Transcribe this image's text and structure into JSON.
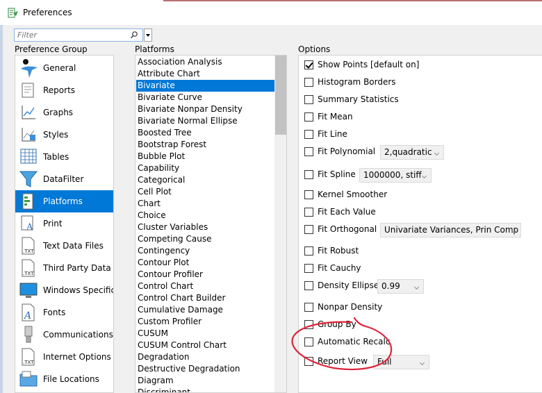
{
  "window": {
    "title": "Preferences"
  },
  "filter": {
    "placeholder": "Filter"
  },
  "labels": {
    "preference_group": "Preference Group",
    "platforms": "Platforms",
    "options": "Options"
  },
  "preference_groups": [
    {
      "label": "General",
      "icon": "general-icon",
      "selected": false
    },
    {
      "label": "Reports",
      "icon": "reports-icon",
      "selected": false
    },
    {
      "label": "Graphs",
      "icon": "graphs-icon",
      "selected": false
    },
    {
      "label": "Styles",
      "icon": "styles-icon",
      "selected": false
    },
    {
      "label": "Tables",
      "icon": "tables-icon",
      "selected": false
    },
    {
      "label": "DataFilter",
      "icon": "datafilter-icon",
      "selected": false
    },
    {
      "label": "Platforms",
      "icon": "platforms-icon",
      "selected": true
    },
    {
      "label": "Print",
      "icon": "print-icon",
      "selected": false
    },
    {
      "label": "Text Data Files",
      "icon": "text-data-files-icon",
      "selected": false
    },
    {
      "label": "Third Party Data",
      "icon": "third-party-data-icon",
      "selected": false
    },
    {
      "label": "Windows Specific",
      "icon": "windows-specific-icon",
      "selected": false
    },
    {
      "label": "Fonts",
      "icon": "fonts-icon",
      "selected": false
    },
    {
      "label": "Communications",
      "icon": "communications-icon",
      "selected": false
    },
    {
      "label": "Internet Options",
      "icon": "internet-options-icon",
      "selected": false
    },
    {
      "label": "File Locations",
      "icon": "file-locations-icon",
      "selected": false
    }
  ],
  "platforms": [
    {
      "label": "Association Analysis",
      "selected": false
    },
    {
      "label": "Attribute Chart",
      "selected": false
    },
    {
      "label": "Bivariate",
      "selected": true
    },
    {
      "label": "Bivariate Curve",
      "selected": false
    },
    {
      "label": "Bivariate Nonpar Density",
      "selected": false
    },
    {
      "label": "Bivariate Normal Ellipse",
      "selected": false
    },
    {
      "label": "Boosted Tree",
      "selected": false
    },
    {
      "label": "Bootstrap Forest",
      "selected": false
    },
    {
      "label": "Bubble Plot",
      "selected": false
    },
    {
      "label": "Capability",
      "selected": false
    },
    {
      "label": "Categorical",
      "selected": false
    },
    {
      "label": "Cell Plot",
      "selected": false
    },
    {
      "label": "Chart",
      "selected": false
    },
    {
      "label": "Choice",
      "selected": false
    },
    {
      "label": "Cluster Variables",
      "selected": false
    },
    {
      "label": "Competing Cause",
      "selected": false
    },
    {
      "label": "Contingency",
      "selected": false
    },
    {
      "label": "Contour Plot",
      "selected": false
    },
    {
      "label": "Contour Profiler",
      "selected": false
    },
    {
      "label": "Control Chart",
      "selected": false
    },
    {
      "label": "Control Chart Builder",
      "selected": false
    },
    {
      "label": "Cumulative Damage",
      "selected": false
    },
    {
      "label": "Custom Profiler",
      "selected": false
    },
    {
      "label": "CUSUM",
      "selected": false
    },
    {
      "label": "CUSUM Control Chart",
      "selected": false
    },
    {
      "label": "Degradation",
      "selected": false
    },
    {
      "label": "Destructive Degradation",
      "selected": false
    },
    {
      "label": "Diagram",
      "selected": false
    },
    {
      "label": "Discriminant",
      "selected": false
    }
  ],
  "options": [
    {
      "label": "Show Points [default on]",
      "checked": true,
      "select": null
    },
    {
      "label": "Histogram Borders",
      "checked": false,
      "select": null
    },
    {
      "label": "Summary Statistics",
      "checked": false,
      "select": null
    },
    {
      "label": "Fit Mean",
      "checked": false,
      "select": null
    },
    {
      "label": "Fit Line",
      "checked": false,
      "select": null
    },
    {
      "label": "Fit Polynomial",
      "checked": false,
      "select": "2,quadratic"
    },
    {
      "label": "Fit Spline",
      "checked": false,
      "select": "1000000, stiff"
    },
    {
      "label": "Kernel Smoother",
      "checked": false,
      "select": null
    },
    {
      "label": "Fit Each Value",
      "checked": false,
      "select": null
    },
    {
      "label": "Fit Orthogonal",
      "checked": false,
      "select": "Univariate Variances, Prin Comp"
    },
    {
      "label": "Fit Robust",
      "checked": false,
      "select": null
    },
    {
      "label": "Fit Cauchy",
      "checked": false,
      "select": null
    },
    {
      "label": "Density Ellipse",
      "checked": false,
      "select": "0.99"
    },
    {
      "label": "Nonpar Density",
      "checked": false,
      "select": null
    },
    {
      "label": "Group By",
      "checked": false,
      "select": null
    },
    {
      "label": "Automatic Recalc",
      "checked": false,
      "select": null
    },
    {
      "label": "Report View",
      "checked": false,
      "select": "Full"
    }
  ],
  "colors": {
    "selection": "#0078d7",
    "annotation": "#e0243a"
  }
}
